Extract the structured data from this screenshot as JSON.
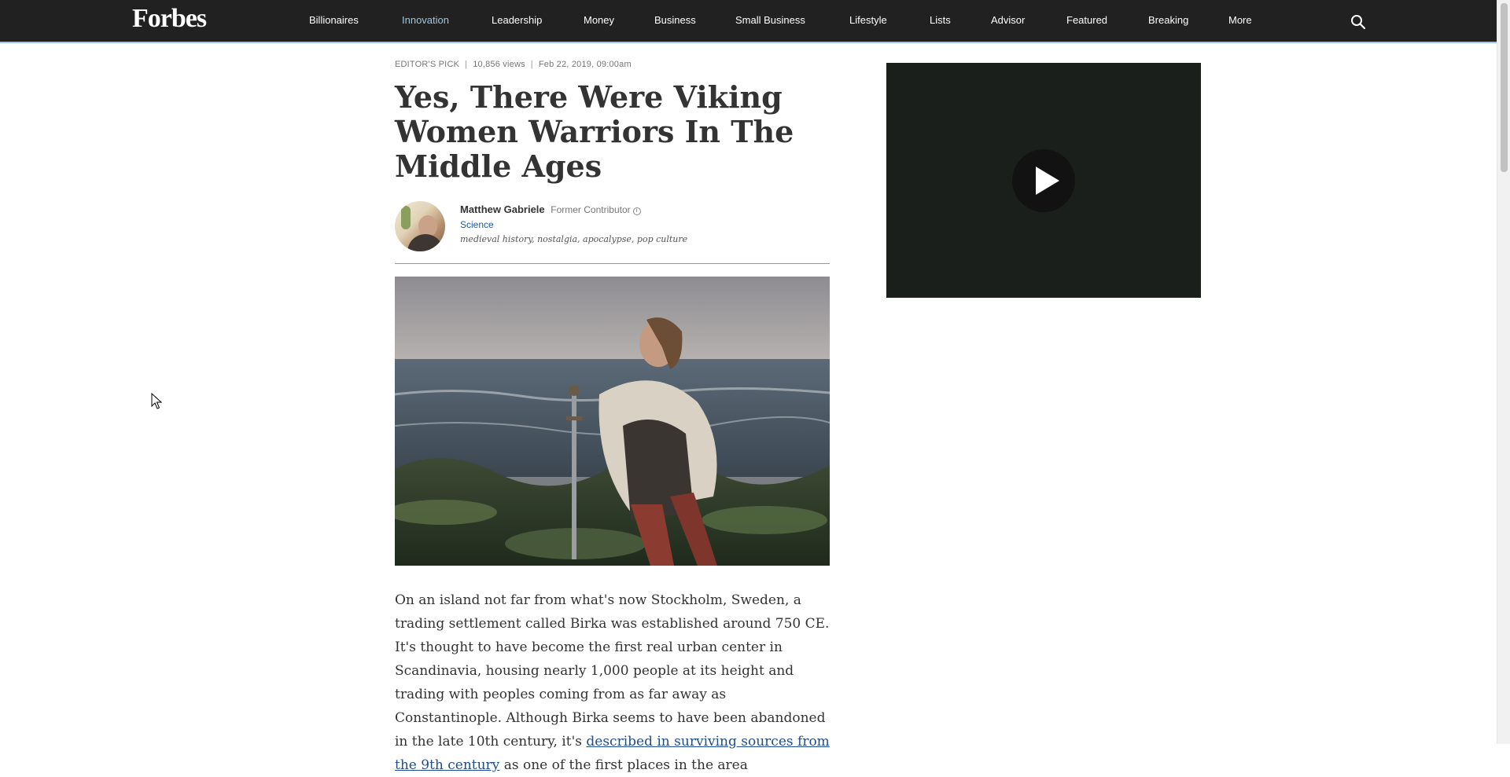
{
  "nav": {
    "logo": "Forbes",
    "items": [
      {
        "label": "Billionaires",
        "active": false
      },
      {
        "label": "Innovation",
        "active": true
      },
      {
        "label": "Leadership",
        "active": false
      },
      {
        "label": "Money",
        "active": false
      },
      {
        "label": "Business",
        "active": false
      },
      {
        "label": "Small Business",
        "active": false
      },
      {
        "label": "Lifestyle",
        "active": false
      },
      {
        "label": "Lists",
        "active": false
      },
      {
        "label": "Advisor",
        "active": false
      },
      {
        "label": "Featured",
        "active": false
      },
      {
        "label": "Breaking",
        "active": false
      },
      {
        "label": "More",
        "active": false
      }
    ],
    "search_icon": "search-icon"
  },
  "article": {
    "meta": {
      "pick": "EDITOR'S PICK",
      "views": "10,856 views",
      "date": "Feb 22, 2019, 09:00am"
    },
    "headline": "Yes, There Were Viking Women Warriors In The Middle Ages",
    "author": {
      "name": "Matthew Gabriele",
      "role": "Former Contributor",
      "section": "Science",
      "tags": "medieval history, nostalgia, apocalypse, pop culture"
    },
    "body": {
      "text_before_link": "On an island not far from what's now Stockholm, Sweden, a trading settlement called Birka was established around 750 CE. It's thought to have become the first real urban center in Scandinavia, housing nearly 1,000 people at its height and trading with peoples coming from as far away as Constantinople. Although Birka seems to have been abandoned in the late 10th century, it's ",
      "link_text": "described in surviving sources from the 9th century",
      "text_after_link": " as one of the first places in the area"
    }
  },
  "video": {
    "play_icon": "play-icon"
  },
  "colors": {
    "nav_bg": "#212121",
    "nav_accent": "#9fc6dc",
    "link": "#1f4e8c",
    "section_link": "#1f5aa6"
  }
}
